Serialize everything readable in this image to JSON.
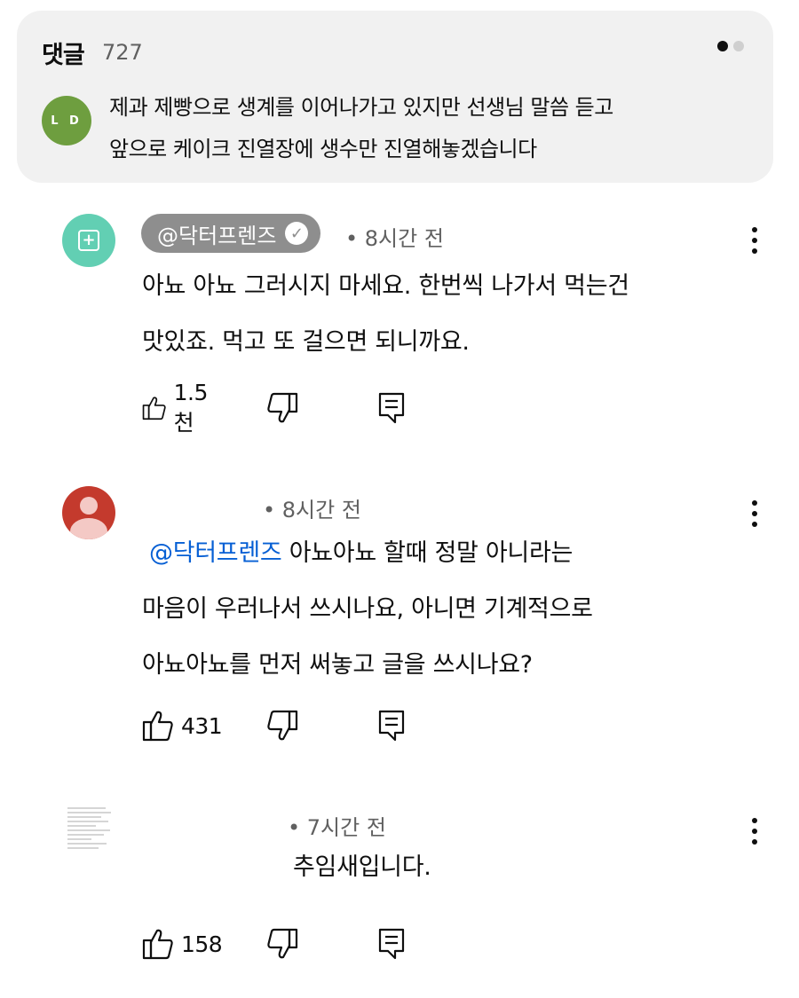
{
  "header": {
    "title": "댓글",
    "count": "727",
    "avatar_text": "L D",
    "pinned_lines": [
      "제과 제빵으로 생계를 이어나가고 있지만 선생님 말씀 듣고",
      "앞으로 케이크 진열장에 생수만 진열해놓겠습니다"
    ]
  },
  "comments": [
    {
      "handle": "@닥터프렌즈",
      "verified": true,
      "time": "• 8시간 전",
      "lines": [
        "아뇨 아뇨 그러시지 마세요. 한번씩 나가서 먹는건",
        "맛있죠. 먹고 또 걸으면 되니까요."
      ],
      "likes": "1.5천"
    },
    {
      "handle": "",
      "time": "• 8시간 전",
      "mention": "@닥터프렌즈",
      "lines": [
        "아뇨아뇨 할때 정말 아니라는",
        "마음이 우러나서 쓰시나요, 아니면 기계적으로",
        "아뇨아뇨를 먼저 써놓고 글을 쓰시나요?"
      ],
      "likes": "431"
    },
    {
      "handle": "",
      "time": "• 7시간 전",
      "lines": [
        "추임새입니다."
      ],
      "likes": "158"
    }
  ],
  "colors": {
    "mention": "#065fd4",
    "card_bg": "#f1f1f1",
    "verified_pill": "#8e8e8e"
  },
  "icons": [
    "thumbs-up-icon",
    "thumbs-down-icon",
    "reply-icon",
    "more-vertical-icon",
    "verified-check-icon"
  ]
}
